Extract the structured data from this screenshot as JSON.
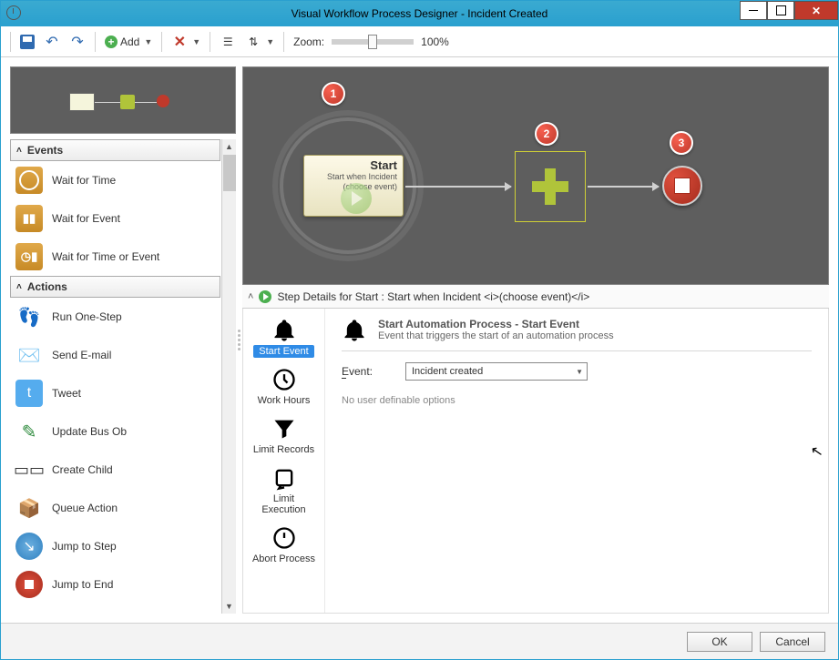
{
  "window": {
    "title": "Visual Workflow Process Designer - Incident Created"
  },
  "toolbar": {
    "add_label": "Add",
    "zoom_label": "Zoom:",
    "zoom_value": "100%"
  },
  "sidebar": {
    "events_header": "Events",
    "actions_header": "Actions",
    "events": [
      {
        "label": "Wait for Time"
      },
      {
        "label": "Wait for Event"
      },
      {
        "label": "Wait for Time or Event"
      }
    ],
    "actions": [
      {
        "label": "Run One-Step"
      },
      {
        "label": "Send E-mail"
      },
      {
        "label": "Tweet"
      },
      {
        "label": "Update Bus Ob"
      },
      {
        "label": "Create Child"
      },
      {
        "label": "Queue Action"
      },
      {
        "label": "Jump to Step"
      },
      {
        "label": "Jump to End"
      }
    ]
  },
  "canvas": {
    "badges": {
      "one": "1",
      "two": "2",
      "three": "3"
    },
    "start_title": "Start",
    "start_sub": "Start when Incident (choose event)"
  },
  "details": {
    "bar_text": "Step Details for Start : Start when Incident  <i>(choose event)</i>",
    "tabs": {
      "start_event": "Start Event",
      "work_hours": "Work Hours",
      "limit_records": "Limit Records",
      "limit_execution": "Limit Execution",
      "abort_process": "Abort Process"
    },
    "content": {
      "title": "Start Automation Process - Start Event",
      "subtitle": "Event that triggers the start of an automation process",
      "event_label": "Event:",
      "event_value": "Incident created",
      "note": "No user definable options"
    }
  },
  "buttons": {
    "ok": "OK",
    "cancel": "Cancel"
  }
}
